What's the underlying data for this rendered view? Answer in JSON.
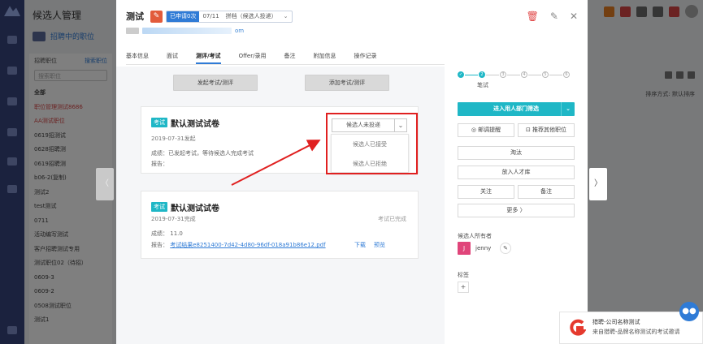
{
  "background": {
    "app_title": "候选人管理",
    "sub_title": "招聘中的职位",
    "sub_link": "",
    "list_header_left": "招聘职位",
    "list_header_right": "搜索职位",
    "search_placeholder": "搜索职位",
    "list_items": [
      "全部",
      "职位管理测试8686",
      "AA测试职位",
      "0619招测试",
      "0628招聘测",
      "0619招聘测",
      "b06-2(复制)",
      "测试2",
      "test测试",
      "0711",
      "活动编写测试",
      "客户招聘测试专用",
      "测试职位02（待招）",
      "0609-3",
      "0609-2",
      "0508测试职位",
      "测试1"
    ],
    "sort_label": "排序方式: 默认排序"
  },
  "modal": {
    "candidate_name": "测试",
    "status": {
      "stage": "已申请0次",
      "date": "07/11",
      "result": "拼档（候选人投递）",
      "chevron": "⌄"
    },
    "contact_suffix": "om",
    "actions": {
      "delete": "🗑",
      "edit": "✎",
      "close": "✕"
    },
    "tabs": [
      "基本信息",
      "面试",
      "测评/考试",
      "Offer/录用",
      "备注",
      "附加信息",
      "操作记录"
    ],
    "active_tab": 2,
    "left": {
      "btn_launch": "发起考试/测评",
      "btn_add": "添加考试/测评",
      "card1": {
        "tag": "考试",
        "title": "默认测试试卷",
        "date": "2019-07-31发起",
        "result_line": "成绩：已发起考试，等待候选人完成考试",
        "report_line": "报告：",
        "select_value": "候选人未投递",
        "select_chevron": "⌄",
        "options": [
          "候选人已接受",
          "候选人已拒绝"
        ]
      },
      "card2": {
        "tag": "考试",
        "title": "默认测试试卷",
        "date": "2019-07-31完成",
        "status": "考试已完成",
        "score_label": "成绩：",
        "score_value": "11.0",
        "report_label": "报告：",
        "report_link": "考试结果e8251400-7d42-4d80-96df-018a91b86e12.pdf",
        "download": "下载",
        "preview": "预览"
      }
    },
    "right": {
      "steps": [
        "✓",
        "2",
        "3",
        "4",
        "5",
        "6"
      ],
      "step_label": "笔试",
      "primary_btn": "进入用人部门筛选",
      "primary_split": "⌄",
      "btn_remind": "◎ 邮调提醒",
      "btn_recommend": "⊡ 推荐其他职位",
      "btn_eliminate": "淘汰",
      "btn_talent": "放入人才库",
      "btn_follow": "关注",
      "btn_note": "备注",
      "btn_more": "更多 〉",
      "owner_title": "候选人所有者",
      "owner_initial": "J",
      "owner_name": "jenny",
      "owner_edit": "✎",
      "tags_title": "标签",
      "tag_add": "+"
    }
  },
  "side_prev": "〈",
  "side_next": "〉",
  "toast": {
    "line1": "猎聘-公司名称测试",
    "line2": "来自猎聘-品牌名称测试的考试邀请"
  },
  "chat_icon": "●●"
}
